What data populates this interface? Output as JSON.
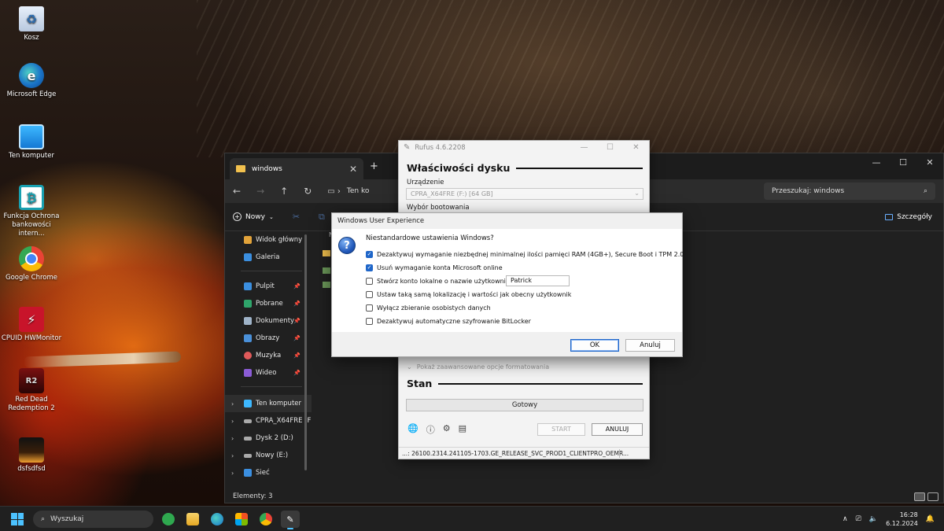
{
  "desktop": {
    "icons": [
      {
        "label": "Kosz",
        "icon": "recycle-bin-icon"
      },
      {
        "label": "Microsoft Edge",
        "icon": "edge-icon"
      },
      {
        "label": "Ten komputer",
        "icon": "computer-icon"
      },
      {
        "label": "Funkcja Ochrona bankowości intern...",
        "icon": "bank-protection-icon"
      },
      {
        "label": "Google Chrome",
        "icon": "chrome-icon"
      },
      {
        "label": "CPUID HWMonitor",
        "icon": "hwmonitor-icon"
      },
      {
        "label": "Red Dead Redemption 2",
        "icon": "rdr2-icon"
      },
      {
        "label": "dsfsdfsd",
        "icon": "file-icon"
      }
    ]
  },
  "explorer": {
    "tab_title": "windows",
    "address_crumb": "Ten ko",
    "search_placeholder": "Przeszukaj: windows",
    "new_label": "Nowy",
    "details_label": "Szczegóły",
    "column_header": "N",
    "nav_top": [
      "Widok główny",
      "Galeria"
    ],
    "nav_pinned": [
      "Pulpit",
      "Pobrane",
      "Dokumenty",
      "Obrazy",
      "Muzyka",
      "Wideo"
    ],
    "nav_drives": [
      "Ten komputer",
      "CPRA_X64FRE (F",
      "Dysk 2 (D:)",
      "Nowy (E:)",
      "Sieć"
    ],
    "status": "Elementy: 3"
  },
  "rufus": {
    "title": "Rufus 4.6.2208",
    "section_drive": "Właściwości dysku",
    "device_label": "Urządzenie",
    "device_value": "CPRA_X64FRE (F:) [64 GB]",
    "boot_label": "Wybór bootowania",
    "advanced_toggle": "Pokaż zaawansowane opcje formatowania",
    "section_status": "Stan",
    "progress_text": "Gotowy",
    "start_button": "START",
    "cancel_button": "ANULUJ",
    "statusbar": "...: 26100.2314.241105-1703.GE_RELEASE_SVC_PROD1_CLIENTPRO_OEMR..."
  },
  "dialog": {
    "title": "Windows User Experience",
    "heading": "Niestandardowe ustawienia Windows?",
    "options": [
      {
        "label": "Dezaktywuj wymaganie niezbędnej minimalnej ilości pamięci RAM (4GB+), Secure Boot i TPM 2.0",
        "checked": true
      },
      {
        "label": "Usuń wymaganie konta Microsoft online",
        "checked": true
      },
      {
        "label": "Stwórz konto lokalne o nazwie użytkownika:",
        "checked": false
      },
      {
        "label": "Ustaw taką samą lokalizację i wartości jak obecny użytkownik",
        "checked": false
      },
      {
        "label": "Wyłącz zbieranie osobistych danych",
        "checked": false
      },
      {
        "label": "Dezaktywuj automatyczne szyfrowanie BitLocker",
        "checked": false
      }
    ],
    "username_value": "Patrick",
    "ok_button": "OK",
    "cancel_button": "Anuluj"
  },
  "taskbar": {
    "search_placeholder": "Wyszukaj",
    "time": "16:28",
    "date": "6.12.2024"
  },
  "colors": {
    "accent": "#1f66c9",
    "taskbar_bg": "#202020",
    "explorer_bg": "#202020"
  }
}
